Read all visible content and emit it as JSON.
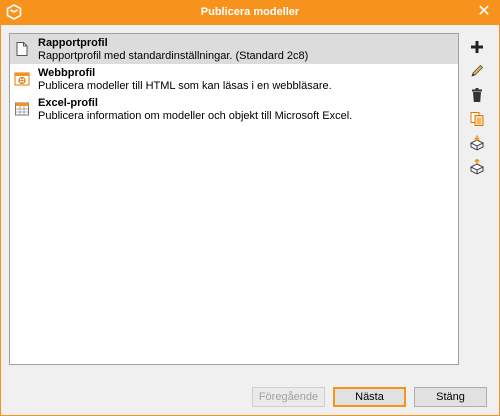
{
  "window": {
    "title": "Publicera modeller",
    "close_symbol": "✕",
    "app_icon": "qualiware-logo-icon"
  },
  "profiles": [
    {
      "name": "Rapportprofil",
      "description": "Rapportprofil med standardinställningar. (Standard 2c8)",
      "icon": "document-icon",
      "selected": true
    },
    {
      "name": "Webbprofil",
      "description": "Publicera modeller till HTML som kan läsas i en webbläsare.",
      "icon": "web-icon",
      "selected": false
    },
    {
      "name": "Excel-profil",
      "description": "Publicera information om modeller och objekt till Microsoft Excel.",
      "icon": "excel-icon",
      "selected": false
    }
  ],
  "toolbar": {
    "tools": [
      "add-icon",
      "edit-icon",
      "delete-icon",
      "copy-icon",
      "import-icon",
      "export-icon"
    ]
  },
  "buttons": {
    "previous": "Föregående",
    "next": "Nästa",
    "close": "Stäng"
  },
  "colors": {
    "accent": "#f7931d",
    "selection": "#dcdcdc"
  }
}
